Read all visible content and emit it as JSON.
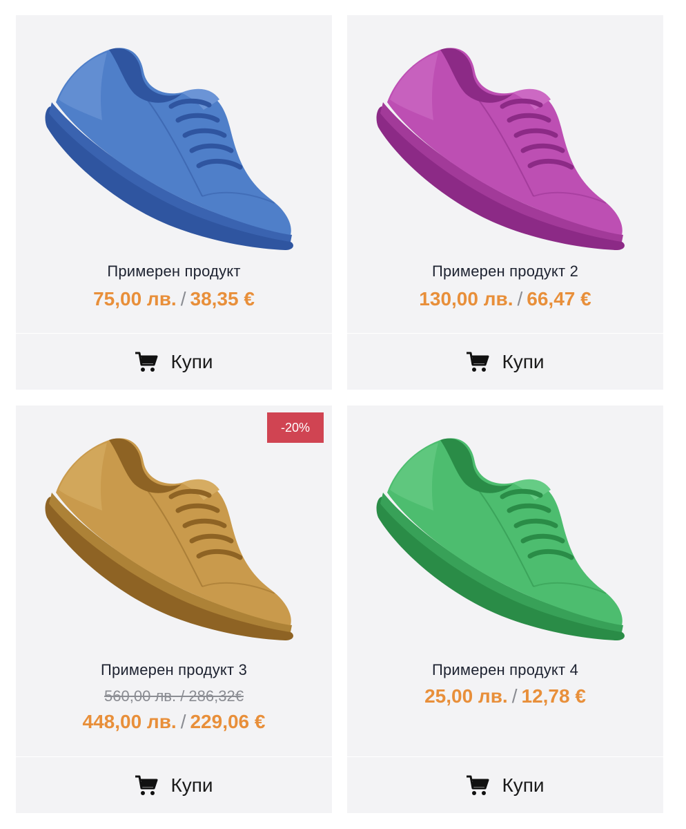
{
  "products": [
    {
      "name": "Примерен продукт",
      "price_bgn": "75,00 лв.",
      "price_sep": "/",
      "price_eur": "38,35 €",
      "buy_label": "Купи",
      "colors": {
        "main": "#4f7fc9",
        "light": "#6b94d6",
        "dark": "#2f55a0",
        "sole": "#3a63b0"
      }
    },
    {
      "name": "Примерен продукт 2",
      "price_bgn": "130,00 лв.",
      "price_sep": "/",
      "price_eur": "66,47 €",
      "buy_label": "Купи",
      "colors": {
        "main": "#bd4fb3",
        "light": "#cc69c3",
        "dark": "#8c2a86",
        "sole": "#a23a99"
      }
    },
    {
      "name": "Примерен продукт 3",
      "old_price": "560,00 лв. / 286,32€",
      "price_bgn": "448,00 лв.",
      "price_sep": "/",
      "price_eur": "229,06 €",
      "badge": "-20%",
      "buy_label": "Купи",
      "colors": {
        "main": "#c99a4c",
        "light": "#d6ac62",
        "dark": "#8e6324",
        "sole": "#ad8237"
      }
    },
    {
      "name": "Примерен продукт 4",
      "price_bgn": "25,00 лв.",
      "price_sep": "/",
      "price_eur": "12,78 €",
      "buy_label": "Купи",
      "colors": {
        "main": "#4dbd6f",
        "light": "#66cc85",
        "dark": "#2a8c47",
        "sole": "#38a158"
      }
    }
  ],
  "icons": {
    "shoe": "sneaker-image",
    "cart": "cart-icon"
  },
  "accent": "#e88f3a",
  "badge_color": "#d04452"
}
